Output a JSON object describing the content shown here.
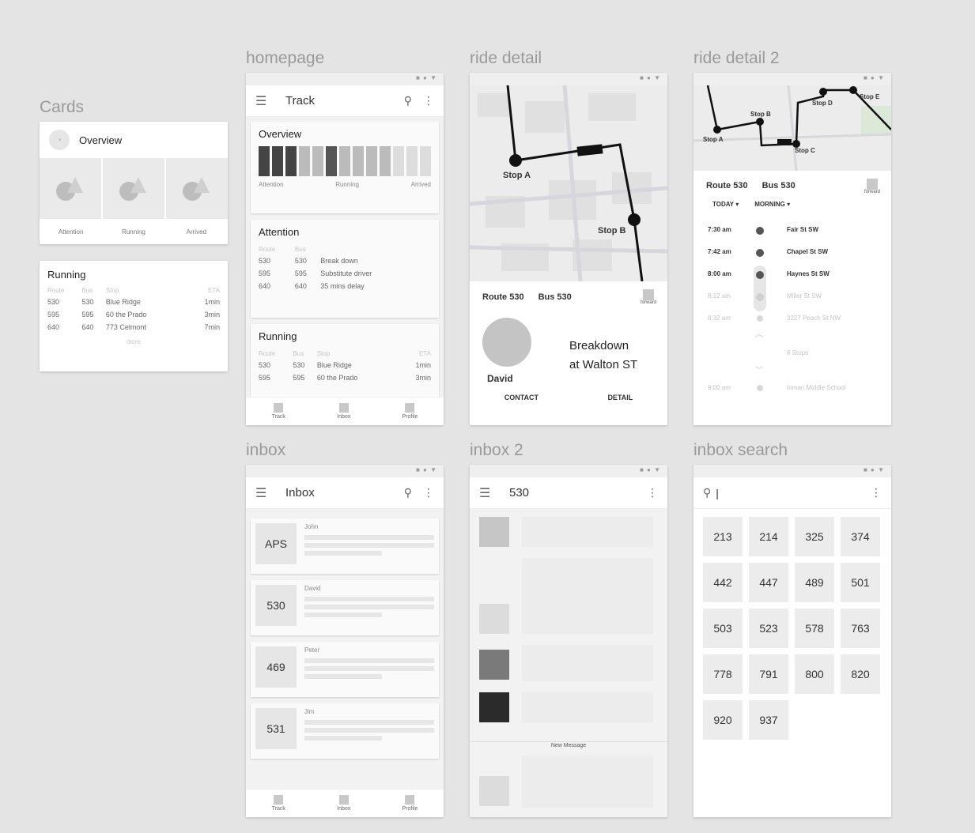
{
  "sections": {
    "cards": "Cards",
    "homepage": "homepage",
    "ride_detail": "ride detail",
    "ride_detail_2": "ride detail 2",
    "inbox": "inbox",
    "inbox_2": "inbox 2",
    "inbox_search": "inbox search"
  },
  "status_icons": "■ ● ▼",
  "cards_overview": {
    "title": "Overview",
    "labels": [
      "Attention",
      "Running",
      "Arrived"
    ]
  },
  "cards_running": {
    "title": "Running",
    "headers": [
      "Route",
      "Bus",
      "Stop",
      "ETA"
    ],
    "rows": [
      [
        "530",
        "530",
        "Blue Ridge",
        "1min"
      ],
      [
        "595",
        "595",
        "60 the Prado",
        "3min"
      ],
      [
        "640",
        "640",
        "773 Celmont",
        "7min"
      ]
    ],
    "more": "more"
  },
  "homepage": {
    "title": "Track",
    "overview_title": "Overview",
    "bar_labels": [
      "Attention",
      "Running",
      "Arrived"
    ],
    "attention_title": "Attention",
    "attention_headers": [
      "Route",
      "Bus"
    ],
    "attention_rows": [
      [
        "530",
        "530",
        "Break down"
      ],
      [
        "595",
        "595",
        "Substitute driver"
      ],
      [
        "640",
        "640",
        "35 mins delay"
      ]
    ],
    "running_title": "Running",
    "running_headers": [
      "Route",
      "Bus",
      "Stop",
      "ETA"
    ],
    "running_rows": [
      [
        "530",
        "530",
        "Blue Ridge",
        "1min"
      ],
      [
        "595",
        "595",
        "60 the Prado",
        "3min"
      ]
    ],
    "nav": [
      "Track",
      "Inbox",
      "Profile"
    ]
  },
  "ride_detail": {
    "stop_a": "Stop A",
    "stop_b": "Stop B",
    "route": "Route 530",
    "bus": "Bus 530",
    "forward": "forward",
    "driver": "David",
    "message_line1": "Breakdown",
    "message_line2": "at Walton ST",
    "contact": "CONTACT",
    "detail": "DETAIL"
  },
  "ride_detail_2": {
    "stops": [
      "Stop A",
      "Stop B",
      "Stop C",
      "Stop D",
      "Stop E"
    ],
    "route": "Route 530",
    "bus": "Bus 530",
    "forward": "forward",
    "today": "TODAY ▾",
    "morning": "MORNING ▾",
    "timeline": [
      {
        "time": "7:30 am",
        "stop": "Fair St SW",
        "done": true
      },
      {
        "time": "7:42 am",
        "stop": "Chapel St SW",
        "done": true
      },
      {
        "time": "8:00 am",
        "stop": "Haynes St SW",
        "done": true
      },
      {
        "time": "8:12 am",
        "stop": "Miller St SW",
        "done": false
      },
      {
        "time": "8:32 am",
        "stop": "3227 Peach St NW",
        "done": false
      }
    ],
    "collapsed": "8 Stops",
    "last_time": "9:00 am",
    "last_stop": "Inman Middle School"
  },
  "inbox": {
    "title": "Inbox",
    "items": [
      {
        "badge": "APS",
        "name": "John"
      },
      {
        "badge": "530",
        "name": "David"
      },
      {
        "badge": "469",
        "name": "Peter"
      },
      {
        "badge": "531",
        "name": "Jim"
      }
    ],
    "nav": [
      "Track",
      "Inbox",
      "Profile"
    ]
  },
  "inbox_2": {
    "title": "530",
    "new_message": "New Message"
  },
  "inbox_search": {
    "numbers": [
      "213",
      "214",
      "325",
      "374",
      "442",
      "447",
      "489",
      "501",
      "503",
      "523",
      "578",
      "763",
      "778",
      "791",
      "800",
      "820",
      "920",
      "937"
    ]
  }
}
